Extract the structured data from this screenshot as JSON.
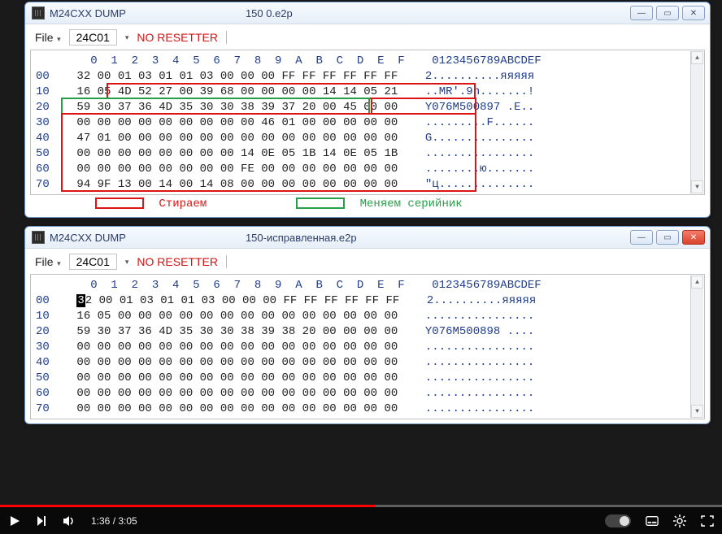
{
  "windows": [
    {
      "title_prefix": "M24CXX DUMP",
      "title_suffix": "150 0.e2p",
      "menu": {
        "file": "File",
        "chip": "24C01",
        "resetter": "NO RESETTER"
      },
      "header_offsets": "        0  1  2  3  4  5  6  7  8  9  A  B  C  D  E  F    0123456789ABCDEF",
      "lines": [
        {
          "off": "00",
          "hex": "32 00 01 03 01 01 03 00 00 00 FF FF FF FF FF FF",
          "asc": "2..........яяяяя"
        },
        {
          "off": "10",
          "hex": "16 05 4D 52 27 00 39 68 00 00 00 00 14 14 05 21",
          "asc": "..MR'.9h.......!"
        },
        {
          "off": "20",
          "hex": "59 30 37 36 4D 35 30 30 38 39 37 20 00 45 00 00",
          "asc": "Y076M500897 .E.."
        },
        {
          "off": "30",
          "hex": "00 00 00 00 00 00 00 00 00 46 01 00 00 00 00 00",
          "asc": ".........F......"
        },
        {
          "off": "40",
          "hex": "47 01 00 00 00 00 00 00 00 00 00 00 00 00 00 00",
          "asc": "G..............."
        },
        {
          "off": "50",
          "hex": "00 00 00 00 00 00 00 00 14 0E 05 1B 14 0E 05 1B",
          "asc": "................"
        },
        {
          "off": "60",
          "hex": "00 00 00 00 00 00 00 00 FE 00 00 00 00 00 00 00",
          "asc": "........ю......."
        },
        {
          "off": "70",
          "hex": "94 9F 13 00 14 00 14 08 00 00 00 00 00 00 00 00",
          "asc": "\"ц.............."
        }
      ],
      "legend": {
        "erase": "Стираем",
        "serial": "Меняем серийник"
      }
    },
    {
      "title_prefix": "M24CXX DUMP",
      "title_suffix": "150-исправленная.e2p",
      "menu": {
        "file": "File",
        "chip": "24C01",
        "resetter": "NO RESETTER"
      },
      "header_offsets": "        0  1  2  3  4  5  6  7  8  9  A  B  C  D  E  F    0123456789ABCDEF",
      "lines": [
        {
          "off": "00",
          "hex": "32 00 01 03 01 01 03 00 00 00 FF FF FF FF FF FF",
          "asc": "2..........яяяяя"
        },
        {
          "off": "10",
          "hex": "16 05 00 00 00 00 00 00 00 00 00 00 00 00 00 00",
          "asc": "................"
        },
        {
          "off": "20",
          "hex": "59 30 37 36 4D 35 30 30 38 39 38 20 00 00 00 00",
          "asc": "Y076M500898 ...."
        },
        {
          "off": "30",
          "hex": "00 00 00 00 00 00 00 00 00 00 00 00 00 00 00 00",
          "asc": "................"
        },
        {
          "off": "40",
          "hex": "00 00 00 00 00 00 00 00 00 00 00 00 00 00 00 00",
          "asc": "................"
        },
        {
          "off": "50",
          "hex": "00 00 00 00 00 00 00 00 00 00 00 00 00 00 00 00",
          "asc": "................"
        },
        {
          "off": "60",
          "hex": "00 00 00 00 00 00 00 00 00 00 00 00 00 00 00 00",
          "asc": "................"
        },
        {
          "off": "70",
          "hex": "00 00 00 00 00 00 00 00 00 00 00 00 00 00 00 00",
          "asc": "................"
        }
      ]
    }
  ],
  "player": {
    "time_current": "1:36",
    "time_total": "3:05",
    "progress_pct": 52
  }
}
